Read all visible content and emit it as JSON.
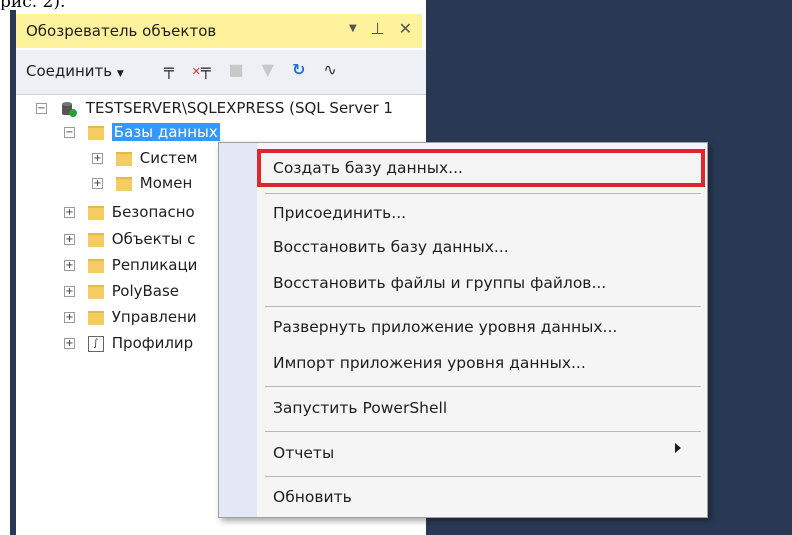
{
  "caption": "рис. 2).",
  "panel": {
    "title": "Обозреватель объектов",
    "pin_icon": "pin-icon",
    "close_icon": "close-icon"
  },
  "toolbar": {
    "connect_label": "Соединить",
    "icons": [
      "connect-icon",
      "disconnect-icon",
      "stop-icon",
      "filter-icon",
      "refresh-icon",
      "activity-icon"
    ]
  },
  "tree": {
    "server": "TESTSERVER\\SQLEXPRESS (SQL Server 1",
    "databases": "Базы данных",
    "children": [
      "Систем",
      "Момен"
    ],
    "items": [
      "Безопасно",
      "Объекты с",
      "Репликаци",
      "PolyBase",
      "Управлени",
      "Профилир"
    ]
  },
  "context_menu": {
    "items": [
      "Создать базу данных...",
      "Присоединить...",
      "Восстановить базу данных...",
      "Восстановить файлы и группы файлов...",
      "Развернуть приложение уровня данных...",
      "Импорт приложения уровня данных...",
      "Запустить PowerShell",
      "Отчеты",
      "Обновить"
    ],
    "highlight_color": "#e0272f"
  }
}
